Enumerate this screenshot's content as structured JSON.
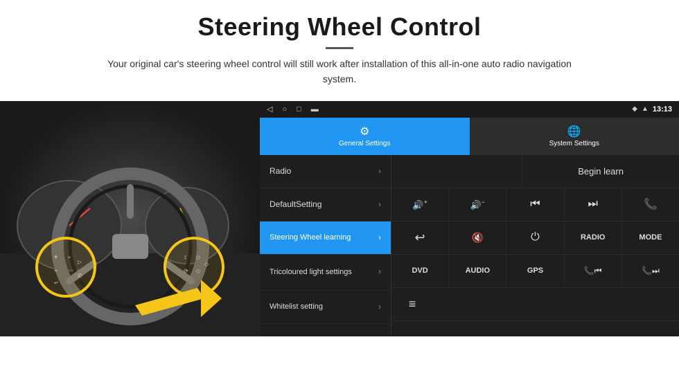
{
  "header": {
    "title": "Steering Wheel Control",
    "subtitle": "Your original car's steering wheel control will still work after installation of this all-in-one auto radio navigation system."
  },
  "status_bar": {
    "nav_icons": [
      "◁",
      "○",
      "□",
      "⬛"
    ],
    "time": "13:13",
    "signal_icon": "◆",
    "wifi_icon": "▲"
  },
  "tabs": [
    {
      "id": "general",
      "label": "General Settings",
      "icon": "⚙",
      "active": true
    },
    {
      "id": "system",
      "label": "System Settings",
      "icon": "🌐",
      "active": false
    }
  ],
  "menu_items": [
    {
      "id": "radio",
      "label": "Radio",
      "active": false
    },
    {
      "id": "default",
      "label": "DefaultSetting",
      "active": false
    },
    {
      "id": "steering",
      "label": "Steering Wheel learning",
      "active": true
    },
    {
      "id": "tricoloured",
      "label": "Tricoloured light settings",
      "active": false
    },
    {
      "id": "whitelist",
      "label": "Whitelist setting",
      "active": false
    }
  ],
  "controls": {
    "begin_learn": "Begin learn",
    "row2": [
      {
        "id": "vol-up",
        "symbol": "🔊+",
        "text": ""
      },
      {
        "id": "vol-down",
        "symbol": "🔊-",
        "text": ""
      },
      {
        "id": "prev-track",
        "symbol": "⏮",
        "text": ""
      },
      {
        "id": "next-track",
        "symbol": "⏭",
        "text": ""
      },
      {
        "id": "phone",
        "symbol": "📞",
        "text": ""
      }
    ],
    "row3": [
      {
        "id": "back",
        "symbol": "↩",
        "text": ""
      },
      {
        "id": "mute",
        "symbol": "🔇",
        "text": ""
      },
      {
        "id": "power",
        "symbol": "⏻",
        "text": ""
      },
      {
        "id": "radio-btn",
        "symbol": "",
        "text": "RADIO"
      },
      {
        "id": "mode-btn",
        "symbol": "",
        "text": "MODE"
      }
    ],
    "row4": [
      {
        "id": "dvd",
        "symbol": "",
        "text": "DVD"
      },
      {
        "id": "audio",
        "symbol": "",
        "text": "AUDIO"
      },
      {
        "id": "gps",
        "symbol": "",
        "text": "GPS"
      },
      {
        "id": "prev-track2",
        "symbol": "📞⏮",
        "text": ""
      },
      {
        "id": "next-track2",
        "symbol": "📞⏭",
        "text": ""
      }
    ],
    "row5": [
      {
        "id": "media",
        "symbol": "≡",
        "text": ""
      }
    ]
  }
}
